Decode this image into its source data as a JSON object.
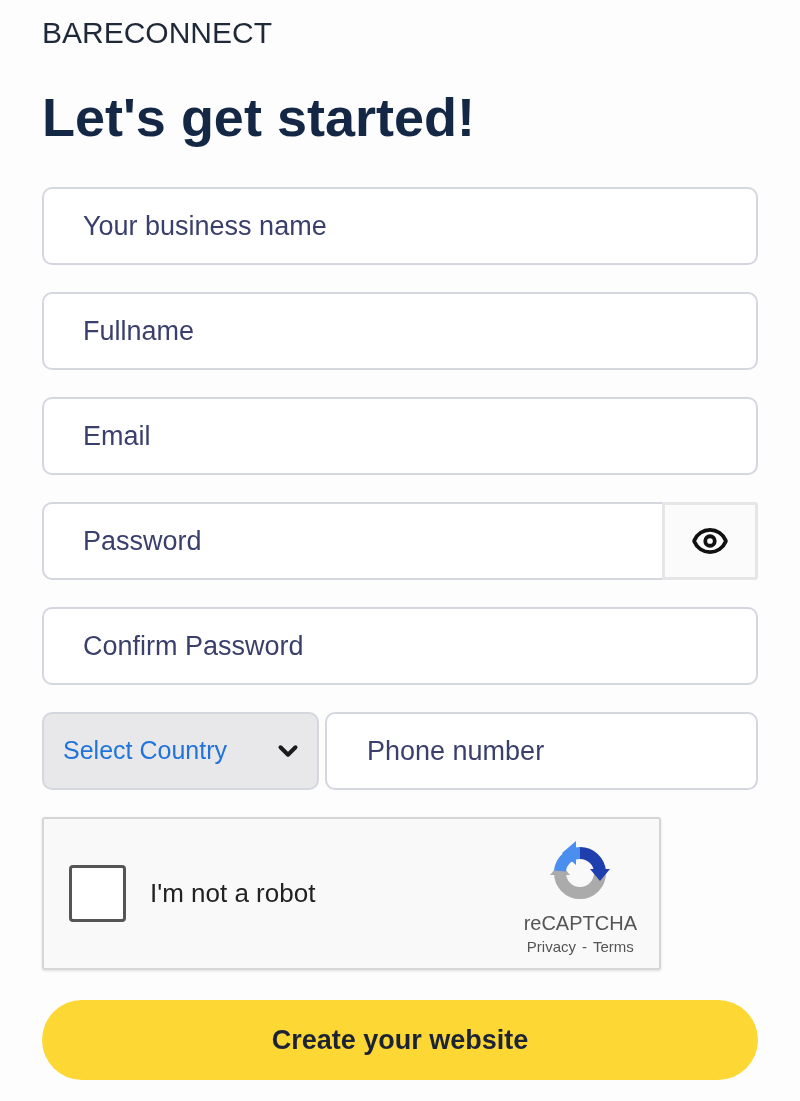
{
  "logo": {
    "text": "BARECONNECT"
  },
  "heading": "Let's get started!",
  "fields": [
    {
      "kind": "text",
      "placeholder": "Your business name"
    },
    {
      "kind": "text",
      "placeholder": "Fullname"
    },
    {
      "kind": "text",
      "placeholder": "Email"
    },
    {
      "kind": "password",
      "placeholder": "Password"
    },
    {
      "kind": "text",
      "placeholder": "Confirm Password"
    }
  ],
  "phone": {
    "country_select": {
      "value": "Select Country"
    },
    "number": {
      "placeholder": "Phone number"
    }
  },
  "captcha": {
    "label": "I'm not a robot",
    "checked": false,
    "brand": "reCAPTCHA",
    "links": [
      "Privacy",
      "Terms"
    ],
    "separator": "-"
  },
  "submit": {
    "label": "Create your website"
  }
}
